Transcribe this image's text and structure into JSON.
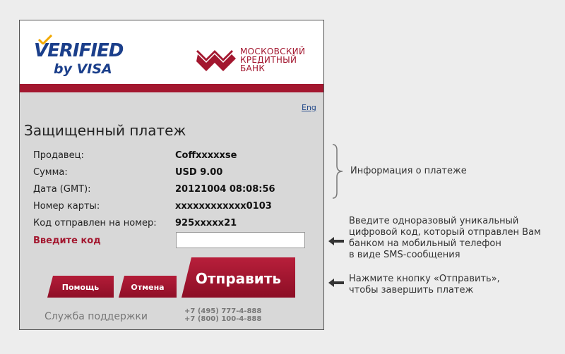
{
  "header": {
    "vbv_logo_line1": "VERIFIED",
    "vbv_logo_line2": "by VISA",
    "bank_name_line1": "МОСКОВСКИЙ",
    "bank_name_line2": "КРЕДИТНЫЙ",
    "bank_name_line3": "БАНК",
    "brand_color": "#a3172f"
  },
  "lang_link": "Eng",
  "title": "Защищенный платеж",
  "fields": [
    {
      "label": "Продавец:",
      "value": "Coffxxxxxse"
    },
    {
      "label": "Сумма:",
      "value": "USD 9.00"
    },
    {
      "label": "Дата (GMT):",
      "value": "20121004 08:08:56"
    },
    {
      "label": "Номер карты:",
      "value": "xxxxxxxxxxxx0103"
    },
    {
      "label": "Код отправлен на номер:",
      "value": "925xxxxx21"
    }
  ],
  "code": {
    "label": "Введите код",
    "value": ""
  },
  "buttons": {
    "help": "Помощь",
    "cancel": "Отмена",
    "submit": "Отправить"
  },
  "support": {
    "label": "Служба поддержки",
    "phone1": "+7 (495) 777-4-888",
    "phone2": "+7 (800) 100-4-888"
  },
  "annotations": {
    "info": "Информация о платеже",
    "code_lines": [
      "Введите одноразовый уникальный",
      "цифровой код, который отправлен Вам",
      "банком на мобильный телефон",
      "в виде SMS-сообщения"
    ],
    "button_lines": [
      "Нажмите кнопку «Отправить»,",
      "чтобы завершить платеж"
    ]
  },
  "icons": [
    "verified-by-visa-logo",
    "mkb-bank-logo",
    "brace-icon",
    "arrow-left-icon"
  ]
}
